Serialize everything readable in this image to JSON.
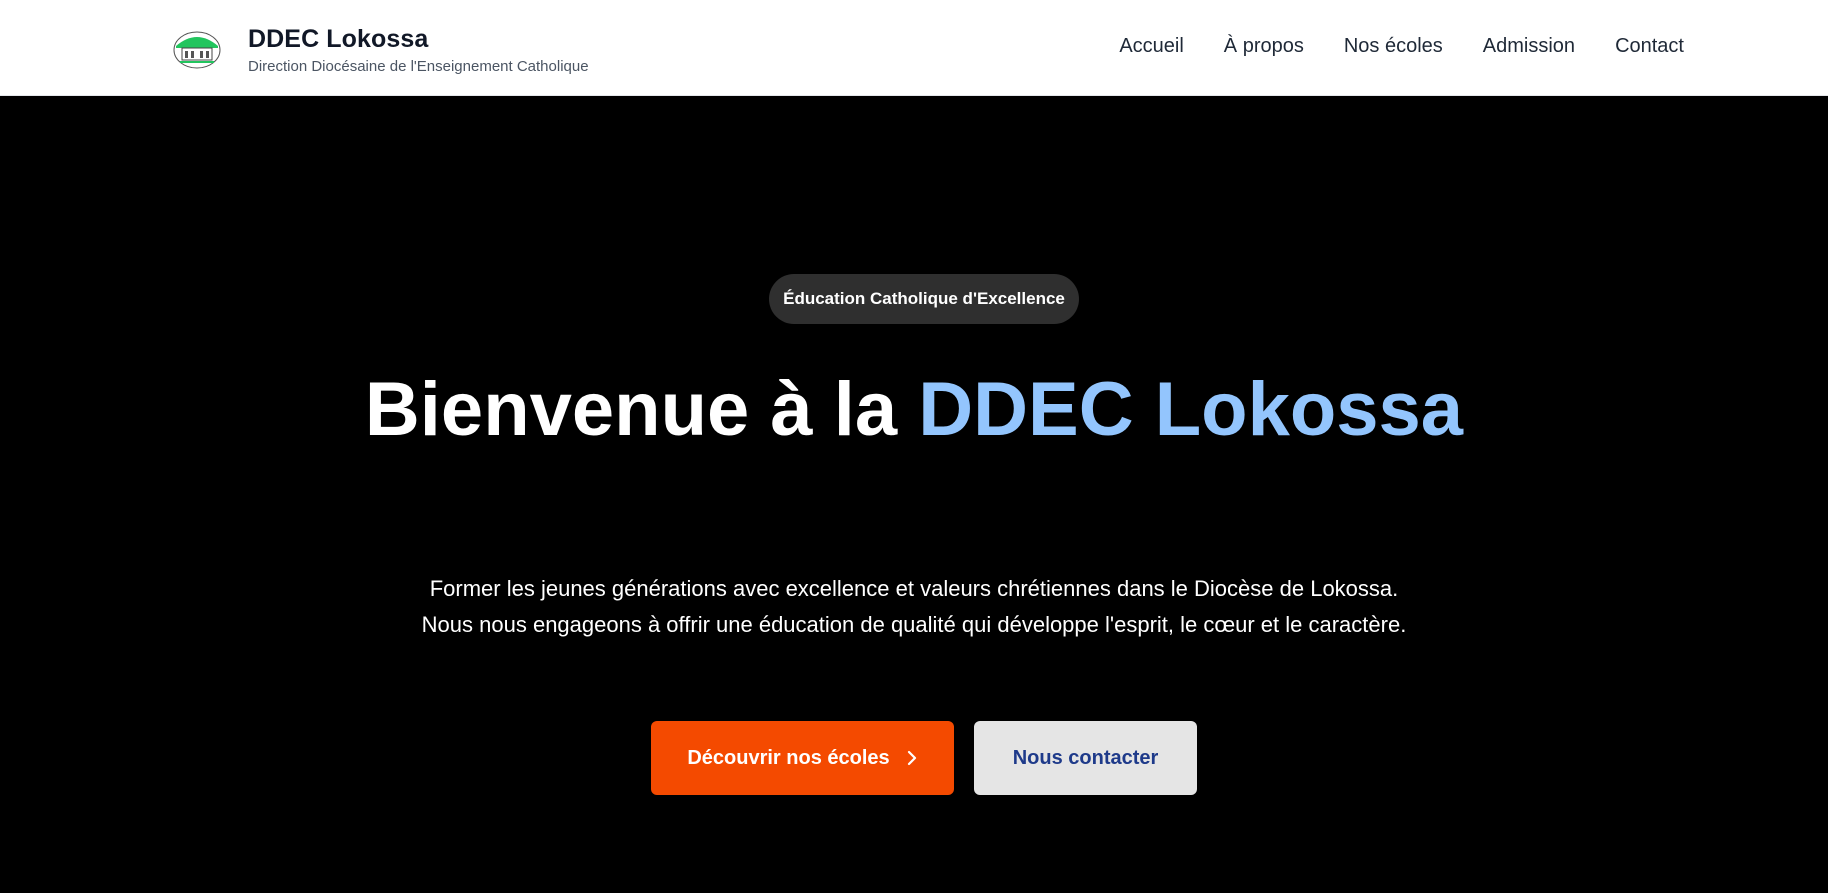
{
  "header": {
    "logo_icon": "diocese-logo-icon",
    "title": "DDEC Lokossa",
    "subtitle": "Direction Diocésaine de l'Enseignement Catholique"
  },
  "nav": {
    "items": [
      {
        "label": "Accueil"
      },
      {
        "label": "À propos"
      },
      {
        "label": "Nos écoles"
      },
      {
        "label": "Admission"
      },
      {
        "label": "Contact"
      }
    ]
  },
  "hero": {
    "badge": "Éducation Catholique d'Excellence",
    "title_part1": "Bienvenue à la ",
    "title_accent": "DDEC Lokossa",
    "description": "Former les jeunes générations avec excellence et valeurs chrétiennes dans le Diocèse de Lokossa. Nous nous engageons à offrir une éducation de qualité qui développe l'esprit, le cœur et le caractère.",
    "primary_button": "Découvrir nos écoles",
    "primary_button_icon": "chevron-right-icon",
    "secondary_button": "Nous contacter"
  },
  "colors": {
    "header_bg": "#ffffff",
    "hero_bg": "#000000",
    "accent_blue": "#93c5fd",
    "primary_orange": "#f44a00",
    "secondary_bg": "#e5e5e5",
    "secondary_text": "#1e3a8a",
    "badge_bg": "#2f2f2f"
  }
}
